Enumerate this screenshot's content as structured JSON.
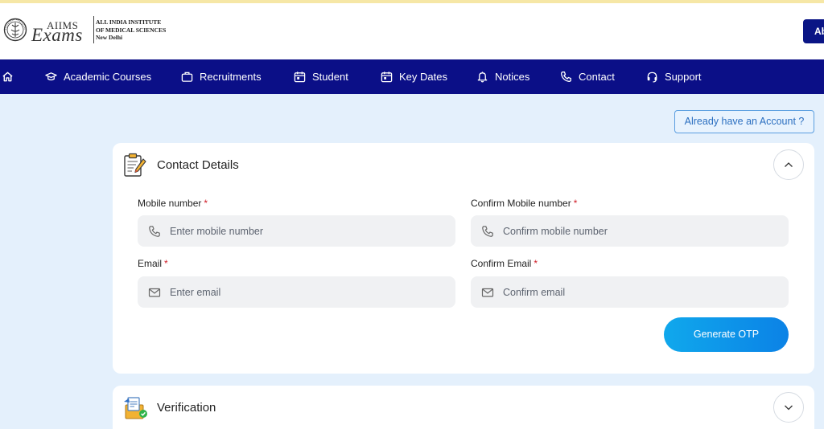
{
  "header": {
    "logo": {
      "wordmark_top": "AIIMS",
      "wordmark_bottom": "Exams",
      "institute_line1": "ALL INDIA INSTITUTE",
      "institute_line2": "OF MEDICAL SCIENCES",
      "institute_line3": "New Delhi"
    },
    "cut_button_label": "Ab"
  },
  "nav": {
    "home_icon": "home-icon",
    "items": [
      {
        "label": "Academic Courses",
        "icon": "graduation-cap-icon"
      },
      {
        "label": "Recruitments",
        "icon": "briefcase-icon"
      },
      {
        "label": "Student",
        "icon": "calendar-icon"
      },
      {
        "label": "Key Dates",
        "icon": "calendar-check-icon"
      },
      {
        "label": "Notices",
        "icon": "bell-icon"
      },
      {
        "label": "Contact",
        "icon": "phone-icon"
      },
      {
        "label": "Support",
        "icon": "headset-icon"
      }
    ]
  },
  "account_link": "Already have an Account ?",
  "contact_card": {
    "title": "Contact Details",
    "icon": "clipboard-pencil-icon",
    "fields": {
      "mobile": {
        "label": "Mobile number",
        "required": "*",
        "placeholder": "Enter mobile number",
        "icon": "phone-icon"
      },
      "confirm_mobile": {
        "label": "Confirm Mobile number",
        "required": "*",
        "placeholder": "Confirm mobile number",
        "icon": "phone-icon"
      },
      "email": {
        "label": "Email",
        "required": "*",
        "placeholder": "Enter email",
        "icon": "mail-icon"
      },
      "confirm_email": {
        "label": "Confirm Email",
        "required": "*",
        "placeholder": "Confirm email",
        "icon": "mail-icon"
      }
    },
    "otp_button": "Generate OTP",
    "toggle": "chevron-up-icon"
  },
  "verification_card": {
    "title": "Verification",
    "icon": "document-check-icon",
    "toggle": "chevron-down-icon"
  },
  "colors": {
    "navbar": "#0b0f87",
    "page_bg": "#e4f0fc",
    "accent_button": "#0b82e6",
    "required_mark": "#d0202a"
  }
}
